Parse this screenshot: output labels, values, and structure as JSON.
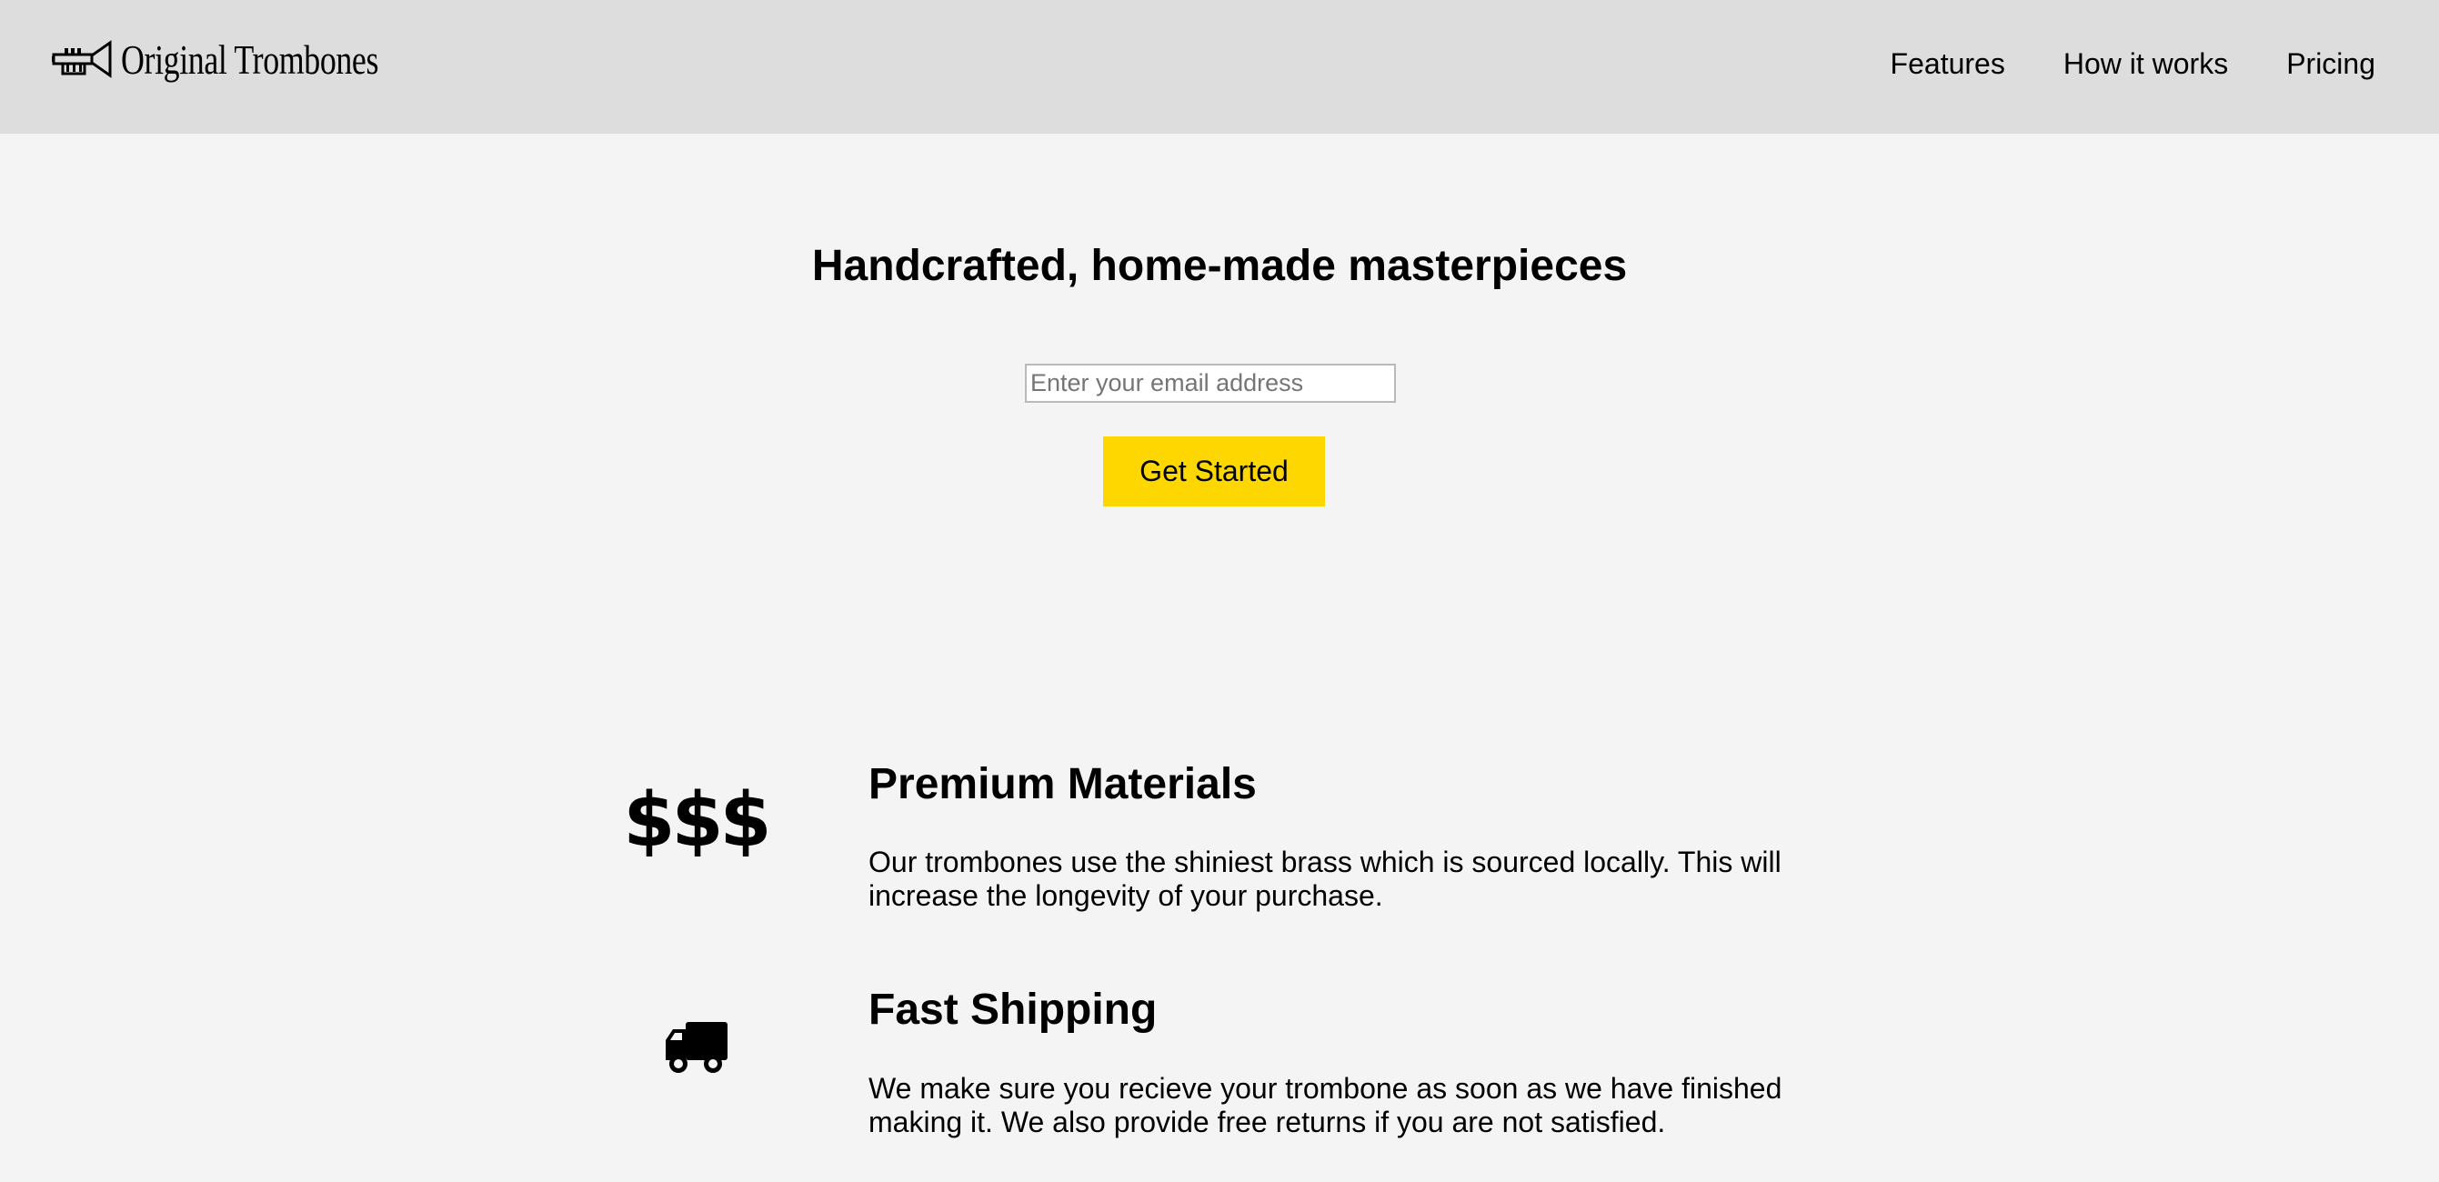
{
  "header": {
    "logo_text": "Original Trombones",
    "logo_icon": "trumpet-icon",
    "nav": [
      {
        "label": "Features"
      },
      {
        "label": "How it works"
      },
      {
        "label": "Pricing"
      }
    ]
  },
  "hero": {
    "title": "Handcrafted, home-made masterpieces",
    "email_placeholder": "Enter your email address",
    "button_label": "Get Started",
    "button_color": "#ffd700"
  },
  "features": [
    {
      "icon": "dollar-icon",
      "icon_text": "$$$",
      "title": "Premium Materials",
      "description": "Our trombones use the shiniest brass which is sourced locally. This will increase the longevity of your purchase."
    },
    {
      "icon": "truck-icon",
      "title": "Fast Shipping",
      "description": "We make sure you recieve your trombone as soon as we have finished making it. We also provide free returns if you are not satisfied."
    }
  ],
  "colors": {
    "header_bg": "#dddddd",
    "page_bg": "#f4f4f4"
  }
}
